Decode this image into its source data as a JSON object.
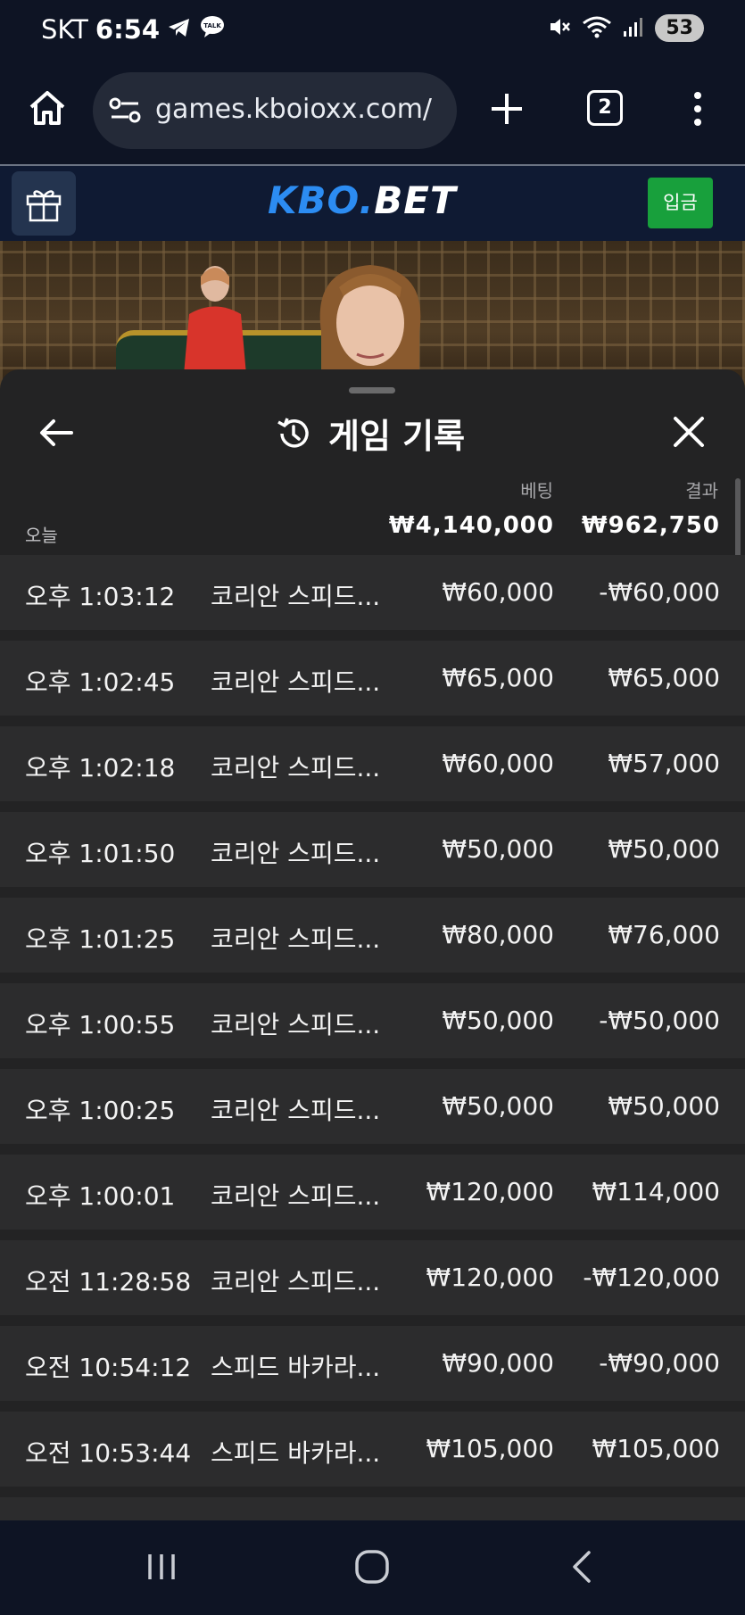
{
  "status_bar": {
    "carrier": "SKT",
    "time": "6:54",
    "battery": "53"
  },
  "browser": {
    "url": "games.kboioxx.com/",
    "tab_count": "2"
  },
  "site": {
    "logo_part1": "KBO.",
    "logo_part2": "BET",
    "deposit_label": "입금"
  },
  "history": {
    "title": "게임 기록",
    "bet_label": "베팅",
    "result_label": "결과",
    "today_label": "오늘",
    "total_bet": "₩4,140,000",
    "total_result": "₩962,750",
    "rows": [
      {
        "time": "오후 1:03:12",
        "game": "코리안 스피드...",
        "bet": "₩60,000",
        "result": "-₩60,000"
      },
      {
        "time": "오후 1:02:45",
        "game": "코리안 스피드...",
        "bet": "₩65,000",
        "result": "₩65,000"
      },
      {
        "time": "오후 1:02:18",
        "game": "코리안 스피드...",
        "bet": "₩60,000",
        "result": "₩57,000"
      },
      {
        "time": "오후 1:01:50",
        "game": "코리안 스피드...",
        "bet": "₩50,000",
        "result": "₩50,000"
      },
      {
        "time": "오후 1:01:25",
        "game": "코리안 스피드...",
        "bet": "₩80,000",
        "result": "₩76,000"
      },
      {
        "time": "오후 1:00:55",
        "game": "코리안 스피드...",
        "bet": "₩50,000",
        "result": "-₩50,000"
      },
      {
        "time": "오후 1:00:25",
        "game": "코리안 스피드...",
        "bet": "₩50,000",
        "result": "₩50,000"
      },
      {
        "time": "오후 1:00:01",
        "game": "코리안 스피드...",
        "bet": "₩120,000",
        "result": "₩114,000"
      },
      {
        "time": "오전 11:28:58",
        "game": "코리안 스피드...",
        "bet": "₩120,000",
        "result": "-₩120,000"
      },
      {
        "time": "오전 10:54:12",
        "game": "스피드 바카라...",
        "bet": "₩90,000",
        "result": "-₩90,000"
      },
      {
        "time": "오전 10:53:44",
        "game": "스피드 바카라...",
        "bet": "₩105,000",
        "result": "₩105,000"
      },
      {
        "time": "",
        "game": "",
        "bet": "",
        "result": ""
      }
    ]
  },
  "colors": {
    "brand_blue": "#2c8cf2",
    "deposit_green": "#18a03c",
    "sheet_bg": "#232324",
    "row_bg": "#2c2c2d"
  }
}
